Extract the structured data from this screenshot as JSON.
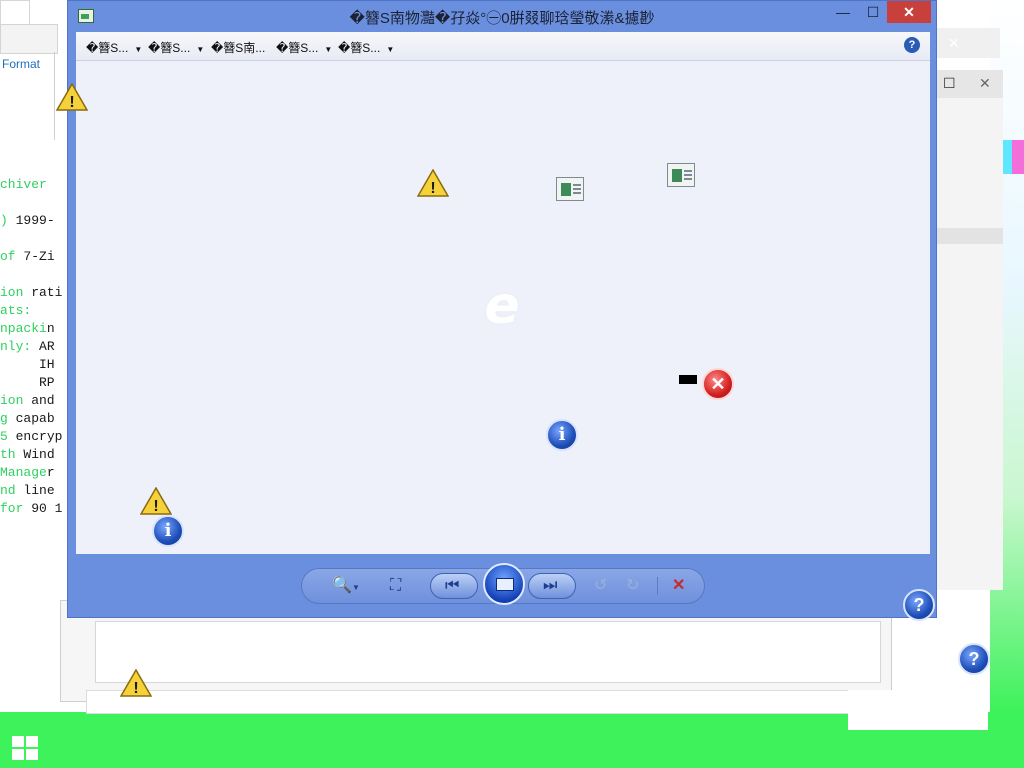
{
  "main_window": {
    "title": "�簪S南物灩�孖焱°㊀0腁叕聊琀瑩敬潫&攄尠",
    "toolbar_items": [
      {
        "label": "�簪S..."
      },
      {
        "label": "�簪S..."
      },
      {
        "label": "�簪S南..."
      },
      {
        "label": "�簪S..."
      },
      {
        "label": "�簪S..."
      }
    ],
    "caption_buttons": {
      "minimize": "—",
      "maximize": "☐",
      "close": "✕"
    },
    "help_glyph": "?"
  },
  "nav_controls": {
    "zoom_icon": "🔍",
    "fit_icon": "⛶",
    "prev_icon": "⏮",
    "next_icon": "⏭",
    "rotate_left_icon": "↺",
    "rotate_right_icon": "↻",
    "delete_icon": "✕"
  },
  "background": {
    "format_label": "Format",
    "console_lines": [
      {
        "prefix": "",
        "text": ""
      },
      {
        "prefix": "",
        "text": ""
      },
      {
        "prefix": "chiver",
        "text": ""
      },
      {
        "prefix": ")",
        "text": " 1999-"
      },
      {
        "prefix": "of",
        "text": " 7-Zi"
      },
      {
        "prefix": "ion",
        "text": " rati"
      },
      {
        "prefix": "ats:",
        "text": ""
      },
      {
        "prefix": "npacki",
        "text": "n"
      },
      {
        "prefix": "nly:",
        "text": " AR"
      },
      {
        "prefix": "",
        "text": "     IH"
      },
      {
        "prefix": "",
        "text": "     RP"
      },
      {
        "prefix": "ion",
        "text": " and"
      },
      {
        "prefix": "g",
        "text": " capab"
      },
      {
        "prefix": "5",
        "text": " encryp"
      },
      {
        "prefix": "th",
        "text": " Wind"
      },
      {
        "prefix": "Manage",
        "text": "r"
      },
      {
        "prefix": "nd",
        "text": " line"
      },
      {
        "prefix": "for",
        "text": " 90 1"
      }
    ],
    "window_buttons": {
      "close": "✕",
      "maximize": "☐"
    }
  },
  "icons": {
    "warning": "!",
    "info": "i",
    "error": "✕",
    "help": "?",
    "ie": "e"
  }
}
